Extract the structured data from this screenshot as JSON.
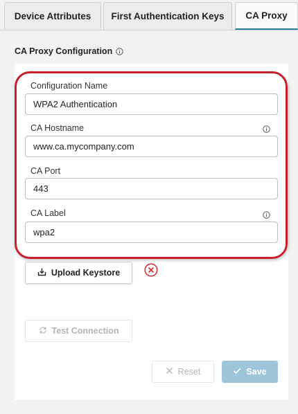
{
  "tabs": [
    {
      "label": "Device Attributes"
    },
    {
      "label": "First Authentication Keys"
    },
    {
      "label": "CA Proxy"
    }
  ],
  "section": {
    "title": "CA Proxy Configuration"
  },
  "form": {
    "config_name": {
      "label": "Configuration Name",
      "value": "WPA2 Authentication"
    },
    "ca_hostname": {
      "label": "CA Hostname",
      "value": "www.ca.mycompany.com"
    },
    "ca_port": {
      "label": "CA Port",
      "value": "443"
    },
    "ca_label": {
      "label": "CA Label",
      "value": "wpa2"
    }
  },
  "buttons": {
    "upload_keystore": "Upload Keystore",
    "test_connection": "Test Connection",
    "reset": "Reset",
    "save": "Save"
  },
  "colors": {
    "highlight": "#c8202a",
    "active_tab_accent": "#2a7f9e",
    "save_button": "#9ec6da",
    "error_icon": "#d9272e"
  },
  "icons": [
    "info-icon",
    "upload-icon",
    "error-x-circle-icon",
    "refresh-icon",
    "close-icon",
    "check-icon"
  ]
}
